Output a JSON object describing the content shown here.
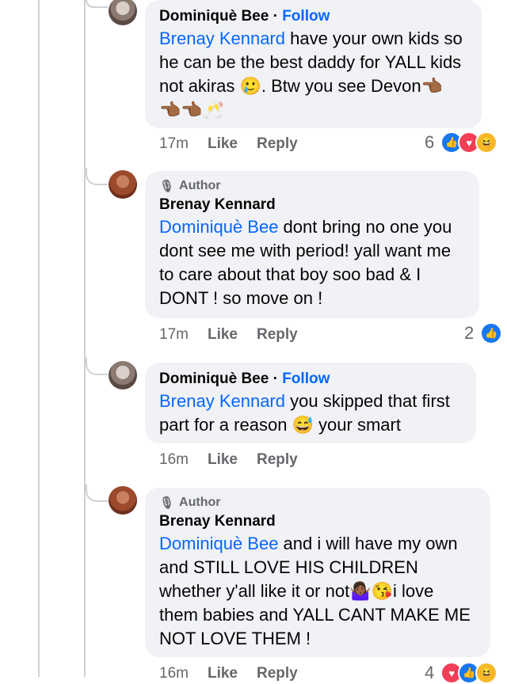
{
  "comments": [
    {
      "name": "Dominiquè Bee",
      "follow": "Follow",
      "dot": "·",
      "mention": "Brenay Kennard",
      "text_line1": " have your own kids so",
      "text_line2": "he can be the best daddy for YALL kids",
      "text_line3": "not akiras 🥲. Btw you see Devon👈🏾",
      "text_line4": "👈🏾👈🏾🥂",
      "time": "17m",
      "like": "Like",
      "reply": "Reply",
      "reaction_count": "6",
      "reactions": [
        "like-icon",
        "love-icon",
        "haha-icon"
      ]
    },
    {
      "author_badge": "Author",
      "name": "Brenay Kennard",
      "mention": "Dominiquè Bee",
      "text_line1": " dont bring no one you",
      "text_line2": "dont see me with period! yall want me",
      "text_line3": "to care about that boy soo bad & I",
      "text_line4": "DONT ! so move on !",
      "time": "17m",
      "like": "Like",
      "reply": "Reply",
      "reaction_count": "2",
      "reactions": [
        "like-icon"
      ]
    },
    {
      "name": "Dominiquè Bee",
      "follow": "Follow",
      "dot": "·",
      "mention": "Brenay Kennard",
      "text_line1": " you skipped that first",
      "text_line2": "part for a reason 😅 your smart",
      "time": "16m",
      "like": "Like",
      "reply": "Reply"
    },
    {
      "author_badge": "Author",
      "name": "Brenay Kennard",
      "mention": "Dominiquè Bee",
      "text_line1": " and i will have my own",
      "text_line2": "and STILL LOVE HIS CHILDREN",
      "text_line3": "whether y'all like it or not🤷🏾‍♀️😘i love",
      "text_line4": "them babies and YALL CANT MAKE ME",
      "text_line5": "NOT LOVE THEM !",
      "time": "16m",
      "like": "Like",
      "reply": "Reply",
      "reaction_count": "4",
      "reactions": [
        "love-icon",
        "like-icon",
        "haha-icon"
      ]
    }
  ],
  "colors": {
    "link": "#0866ff",
    "bubble": "#f0f2f5",
    "meta": "#65676b"
  }
}
